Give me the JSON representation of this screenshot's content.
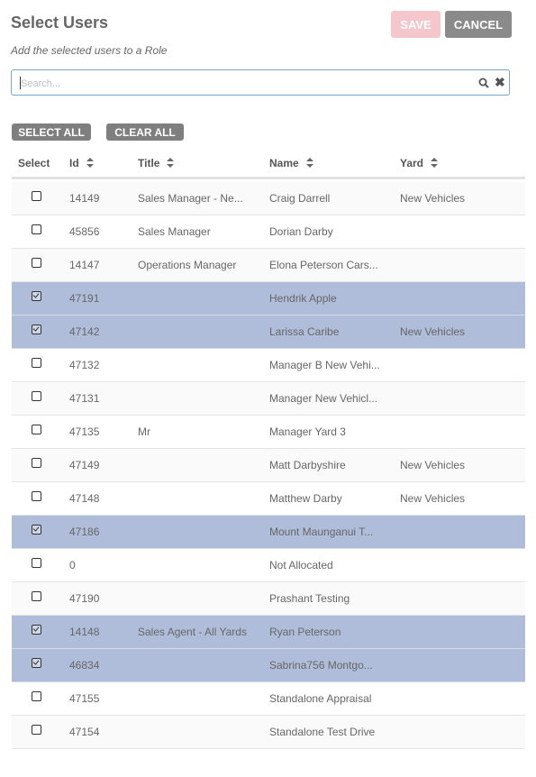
{
  "dialog": {
    "title": "Select Users",
    "subtitle": "Add the selected users to a Role",
    "save_label": "SAVE",
    "cancel_label": "CANCEL"
  },
  "search": {
    "placeholder": "Search...",
    "value": ""
  },
  "bulk": {
    "select_all_label": "SELECT ALL",
    "clear_all_label": "CLEAR ALL"
  },
  "table": {
    "headers": {
      "select": "Select",
      "id": "Id",
      "title": "Title",
      "name": "Name",
      "yard": "Yard"
    },
    "rows": [
      {
        "selected": false,
        "id": "14149",
        "title": "Sales Manager - Ne...",
        "name": "Craig Darrell",
        "yard": "New Vehicles"
      },
      {
        "selected": false,
        "id": "45856",
        "title": "Sales Manager",
        "name": "Dorian Darby",
        "yard": ""
      },
      {
        "selected": false,
        "id": "14147",
        "title": "Operations Manager",
        "name": "Elona Peterson Cars...",
        "yard": ""
      },
      {
        "selected": true,
        "id": "47191",
        "title": "",
        "name": "Hendrik Apple",
        "yard": ""
      },
      {
        "selected": true,
        "id": "47142",
        "title": "",
        "name": "Larissa Caribe",
        "yard": "New Vehicles"
      },
      {
        "selected": false,
        "id": "47132",
        "title": "",
        "name": "Manager B New Vehi...",
        "yard": ""
      },
      {
        "selected": false,
        "id": "47131",
        "title": "",
        "name": "Manager New Vehicl...",
        "yard": ""
      },
      {
        "selected": false,
        "id": "47135",
        "title": "Mr",
        "name": "Manager Yard 3",
        "yard": ""
      },
      {
        "selected": false,
        "id": "47149",
        "title": "",
        "name": "Matt Darbyshire",
        "yard": "New Vehicles"
      },
      {
        "selected": false,
        "id": "47148",
        "title": "",
        "name": "Matthew Darby",
        "yard": "New Vehicles"
      },
      {
        "selected": true,
        "id": "47186",
        "title": "",
        "name": "Mount Maunganui T...",
        "yard": ""
      },
      {
        "selected": false,
        "id": "0",
        "title": "",
        "name": "Not Allocated",
        "yard": ""
      },
      {
        "selected": false,
        "id": "47190",
        "title": "",
        "name": "Prashant Testing",
        "yard": ""
      },
      {
        "selected": true,
        "id": "14148",
        "title": "Sales Agent - All Yards",
        "name": "Ryan Peterson",
        "yard": ""
      },
      {
        "selected": true,
        "id": "46834",
        "title": "",
        "name": "Sabrina756 Montgo...",
        "yard": ""
      },
      {
        "selected": false,
        "id": "47155",
        "title": "",
        "name": "Standalone Appraisal",
        "yard": ""
      },
      {
        "selected": false,
        "id": "47154",
        "title": "",
        "name": "Standalone Test Drive",
        "yard": ""
      }
    ]
  },
  "colors": {
    "selected_row": "#b0bdda",
    "save_disabled": "#f5c6cb",
    "cancel": "#8a8a8a",
    "search_border": "#7aa7c7"
  },
  "icons": {
    "search": "search-icon",
    "clear": "close-icon",
    "sort": "sort-icon"
  }
}
